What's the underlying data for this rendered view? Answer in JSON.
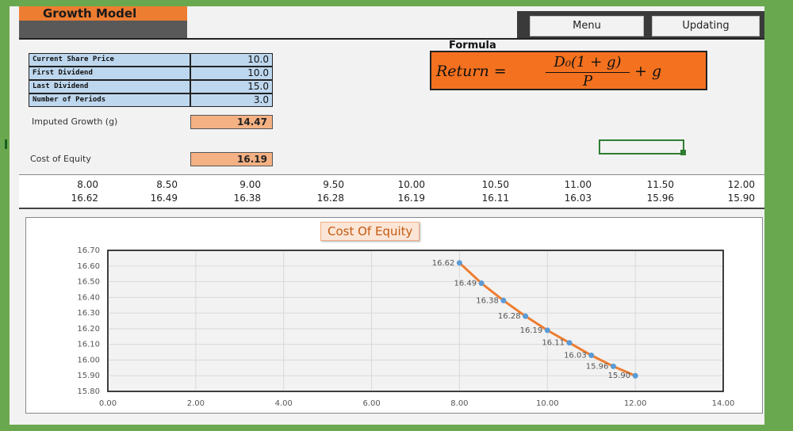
{
  "header": {
    "title": "Growth Model",
    "menu_label": "Menu",
    "updating_label": "Updating"
  },
  "inputs": [
    {
      "label": "Current Share Price",
      "value": "10.0"
    },
    {
      "label": "First Dividend",
      "value": "10.0"
    },
    {
      "label": "Last Dividend",
      "value": "15.0"
    },
    {
      "label": "Number of Periods",
      "value": "3.0"
    }
  ],
  "results": {
    "imputed_growth_label": "Imputed Growth (g)",
    "imputed_growth_value": "14.47",
    "cost_of_equity_label": "Cost of Equity",
    "cost_of_equity_value": "16.19"
  },
  "formula": {
    "title": "Formula",
    "lhs": "Return =",
    "numerator": "D₀(1 + g)",
    "denominator": "P",
    "rhs": "+ g"
  },
  "data_rows": {
    "prices": [
      "8.00",
      "8.50",
      "9.00",
      "9.50",
      "10.00",
      "10.50",
      "11.00",
      "11.50",
      "12.00"
    ],
    "costs": [
      "16.62",
      "16.49",
      "16.38",
      "16.28",
      "16.19",
      "16.11",
      "16.03",
      "15.96",
      "15.90"
    ]
  },
  "chart_data": {
    "type": "line",
    "title": "Cost Of Equity",
    "x": [
      8.0,
      8.5,
      9.0,
      9.5,
      10.0,
      10.5,
      11.0,
      11.5,
      12.0
    ],
    "series": [
      {
        "values": [
          16.62,
          16.49,
          16.38,
          16.28,
          16.19,
          16.11,
          16.03,
          15.96,
          15.9
        ]
      }
    ],
    "data_labels": [
      "16.62",
      "16.49",
      "16.38",
      "16.28",
      "16.19",
      "16.11",
      "16.03",
      "15.96",
      "15.90"
    ],
    "xlim": [
      0,
      14
    ],
    "ylim": [
      15.8,
      16.7
    ],
    "x_ticks": [
      "0.00",
      "2.00",
      "4.00",
      "6.00",
      "8.00",
      "10.00",
      "12.00",
      "14.00"
    ],
    "y_ticks": [
      "15.80",
      "15.90",
      "16.00",
      "16.10",
      "16.20",
      "16.30",
      "16.40",
      "16.50",
      "16.60",
      "16.70"
    ],
    "grid": true,
    "line_color": "#ed7d31",
    "marker_color": "#5b9bd5"
  }
}
